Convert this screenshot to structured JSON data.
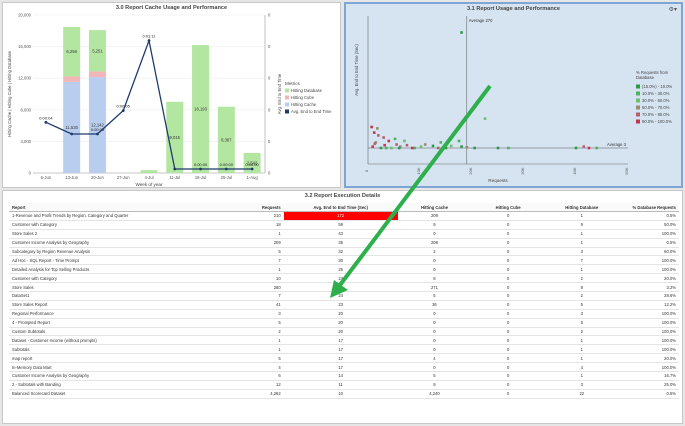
{
  "colors": {
    "db": "#b3e6a1",
    "cube": "#f2b6b6",
    "cache": "#b9cdee",
    "line": "#1f3b6e",
    "green_arrow": "#2db04b",
    "hot": "#ff0000"
  },
  "panel1": {
    "title": "3.0 Report Cache Usage and Performance",
    "legend_title": "Metrics",
    "legend": [
      "Hitting Database",
      "Hitting Cube",
      "Hitting Cache",
      "Avg. End to End Time"
    ],
    "xlabel": "Week of year",
    "ylabel_left": "Hitting Cache | Hitting Cube | Hitting Database",
    "ylabel_right": "Avg. End to End Time",
    "y_ticks": [
      "20,000",
      "16,000",
      "12,000",
      "8,000",
      "4,000",
      "0"
    ],
    "y2_ticks": [
      "0",
      "0",
      "0",
      "0",
      "0",
      "0"
    ]
  },
  "panel2": {
    "title": "3.1 Report Usage and Performance",
    "ylabel": "Avg. End to End Time (Sec)",
    "xlabel": "Requests",
    "avg_label_top": "Average 270",
    "avg_label_right": "Average 3",
    "legend_title": "% Requests from Database",
    "legend": [
      "(15.0%) - 10.0%",
      "10.0% - 30.0%",
      "30.0% - 50.0%",
      "50.0% - 70.0%",
      "70.0% - 90.0%",
      "90.0% - 100.0%"
    ],
    "legend_colors": [
      "#2e9a46",
      "#4bb361",
      "#6cbf6b",
      "#9a8a73",
      "#b5616d",
      "#c4374e"
    ],
    "x_ticks": [
      "0",
      "10K",
      "20K",
      "30K",
      "40K",
      "50K"
    ]
  },
  "chart_data": [
    {
      "type": "bar",
      "title": "3.0 Report Cache Usage and Performance",
      "categories": [
        "6-Jun",
        "13-Jun",
        "20-Jun",
        "27-Jun",
        "4-Jul",
        "11-Jul",
        "18-Jul",
        "25-Jul",
        "1-Aug"
      ],
      "series": [
        {
          "name": "Hitting Cache",
          "values": [
            0,
            11530,
            12142,
            0,
            0,
            0,
            0,
            0,
            0
          ]
        },
        {
          "name": "Hitting Cube",
          "values": [
            0,
            700,
            700,
            0,
            0,
            0,
            0,
            0,
            0
          ]
        },
        {
          "name": "Hitting Database",
          "values": [
            0,
            6256,
            5251,
            0,
            360,
            9015,
            16193,
            8387,
            2542
          ]
        },
        {
          "name": "Avg. End to End Time",
          "values": [
            0.04,
            0.03,
            0.03,
            0.05,
            0.11,
            0.0,
            0.0,
            0.0,
            0.0
          ]
        }
      ],
      "data_labels": [
        "0:00:04",
        "",
        "0:00:03",
        "0:00:05",
        "0:01:11",
        "",
        "0:00:00",
        "0:00:00",
        "0:00:00"
      ],
      "bar_labels": [
        {
          "i": 1,
          "top": "6,256",
          "bottom": "11,530"
        },
        {
          "i": 2,
          "top": "5,251",
          "bottom": "12,142"
        },
        {
          "i": 5,
          "top": "9,015"
        },
        {
          "i": 6,
          "top": "16,193"
        },
        {
          "i": 7,
          "top": "8,387"
        },
        {
          "i": 8,
          "top": "2,542"
        }
      ],
      "ylim": [
        0,
        20000
      ]
    },
    {
      "type": "scatter",
      "title": "3.1 Report Usage and Performance",
      "xlabel": "Requests",
      "ylabel": "Avg. End to End Time (Sec)",
      "xlim": [
        0,
        50000
      ],
      "points": [
        [
          700,
          50,
          5
        ],
        [
          1200,
          42,
          5
        ],
        [
          2000,
          38,
          4
        ],
        [
          1500,
          28,
          3
        ],
        [
          900,
          22,
          5
        ],
        [
          3000,
          35,
          4
        ],
        [
          4000,
          30,
          5
        ],
        [
          5500,
          25,
          4
        ],
        [
          6200,
          22,
          3
        ],
        [
          7000,
          30,
          2
        ],
        [
          7500,
          24,
          4
        ],
        [
          8500,
          20,
          5
        ],
        [
          9000,
          20,
          1
        ],
        [
          10200,
          22,
          2
        ],
        [
          11000,
          25,
          3
        ],
        [
          12500,
          23,
          0
        ],
        [
          13500,
          20,
          4
        ],
        [
          14000,
          28,
          1
        ],
        [
          15000,
          20,
          0
        ],
        [
          16000,
          23,
          2
        ],
        [
          17500,
          30,
          1
        ],
        [
          18000,
          22,
          0
        ],
        [
          19000,
          21,
          3
        ],
        [
          2500,
          20,
          0
        ],
        [
          3500,
          20,
          1
        ],
        [
          4500,
          20,
          2
        ],
        [
          6000,
          20,
          0
        ],
        [
          20500,
          20,
          0
        ],
        [
          22500,
          62,
          2
        ],
        [
          25000,
          20,
          0
        ],
        [
          27000,
          20,
          1
        ],
        [
          40000,
          20,
          0
        ],
        [
          41500,
          22,
          4
        ],
        [
          42500,
          20,
          5
        ],
        [
          44000,
          20,
          1
        ],
        [
          18000,
          185,
          0
        ],
        [
          1800,
          48,
          3
        ],
        [
          1300,
          26,
          4
        ],
        [
          3200,
          24,
          5
        ],
        [
          5200,
          33,
          1
        ]
      ]
    }
  ],
  "panel3": {
    "title": "3.2 Report Execution Details",
    "columns": [
      "Report",
      "Requests",
      "Avg. End to End Time (Sec)",
      "Hitting Cache",
      "Hitting Cube",
      "Hitting Database",
      "% Database Requests"
    ],
    "rows": [
      [
        "1-Revenue and Profit Trends by Region, Category and Quarter",
        "210",
        "172",
        "209",
        "0",
        "1",
        "0.5%"
      ],
      [
        "Customer with Category",
        "18",
        "59",
        "9",
        "0",
        "9",
        "50.0%"
      ],
      [
        "Store Sales 2",
        "1",
        "43",
        "0",
        "0",
        "1",
        "100.0%"
      ],
      [
        "Customer Income Analysis by Geography",
        "209",
        "35",
        "208",
        "0",
        "1",
        "0.5%"
      ],
      [
        "Subcategory by Region Revenue Analysis",
        "5",
        "32",
        "2",
        "0",
        "3",
        "60.0%"
      ],
      [
        "Ad Hoc - SQL Report - Time Prompt",
        "7",
        "30",
        "0",
        "0",
        "7",
        "100.0%"
      ],
      [
        "Detailed Analysis for Top Selling Products",
        "1",
        "25",
        "0",
        "0",
        "1",
        "100.0%"
      ],
      [
        "Customer with Category",
        "10",
        "24",
        "8",
        "0",
        "2",
        "20.0%"
      ],
      [
        "Store Sales",
        "280",
        "24",
        "271",
        "0",
        "9",
        "3.2%"
      ],
      [
        "DataSet1",
        "7",
        "24",
        "5",
        "0",
        "2",
        "28.6%"
      ],
      [
        "Store Sales Report",
        "41",
        "23",
        "36",
        "0",
        "5",
        "12.2%"
      ],
      [
        "Regional Performance",
        "3",
        "20",
        "0",
        "0",
        "3",
        "100.0%"
      ],
      [
        "4 - Prompted Report",
        "5",
        "20",
        "0",
        "0",
        "5",
        "100.0%"
      ],
      [
        "Custom Subtotals",
        "2",
        "20",
        "0",
        "0",
        "2",
        "100.0%"
      ],
      [
        "Dataset - Customer Income (without prompts)",
        "1",
        "17",
        "0",
        "0",
        "1",
        "100.0%"
      ],
      [
        "Subtotals",
        "1",
        "17",
        "0",
        "0",
        "1",
        "100.0%"
      ],
      [
        "map report",
        "5",
        "17",
        "4",
        "0",
        "1",
        "20.0%"
      ],
      [
        "In-Memory Data Mart",
        "4",
        "17",
        "0",
        "0",
        "4",
        "100.0%"
      ],
      [
        "Customer Income Analysis by Geography",
        "6",
        "14",
        "5",
        "0",
        "1",
        "16.7%"
      ],
      [
        "2 - Subtotals with Banding",
        "12",
        "11",
        "9",
        "0",
        "3",
        "25.0%"
      ],
      [
        "Balanced Scorecard Dataset",
        "4,262",
        "10",
        "4,240",
        "0",
        "22",
        "0.5%"
      ]
    ]
  }
}
